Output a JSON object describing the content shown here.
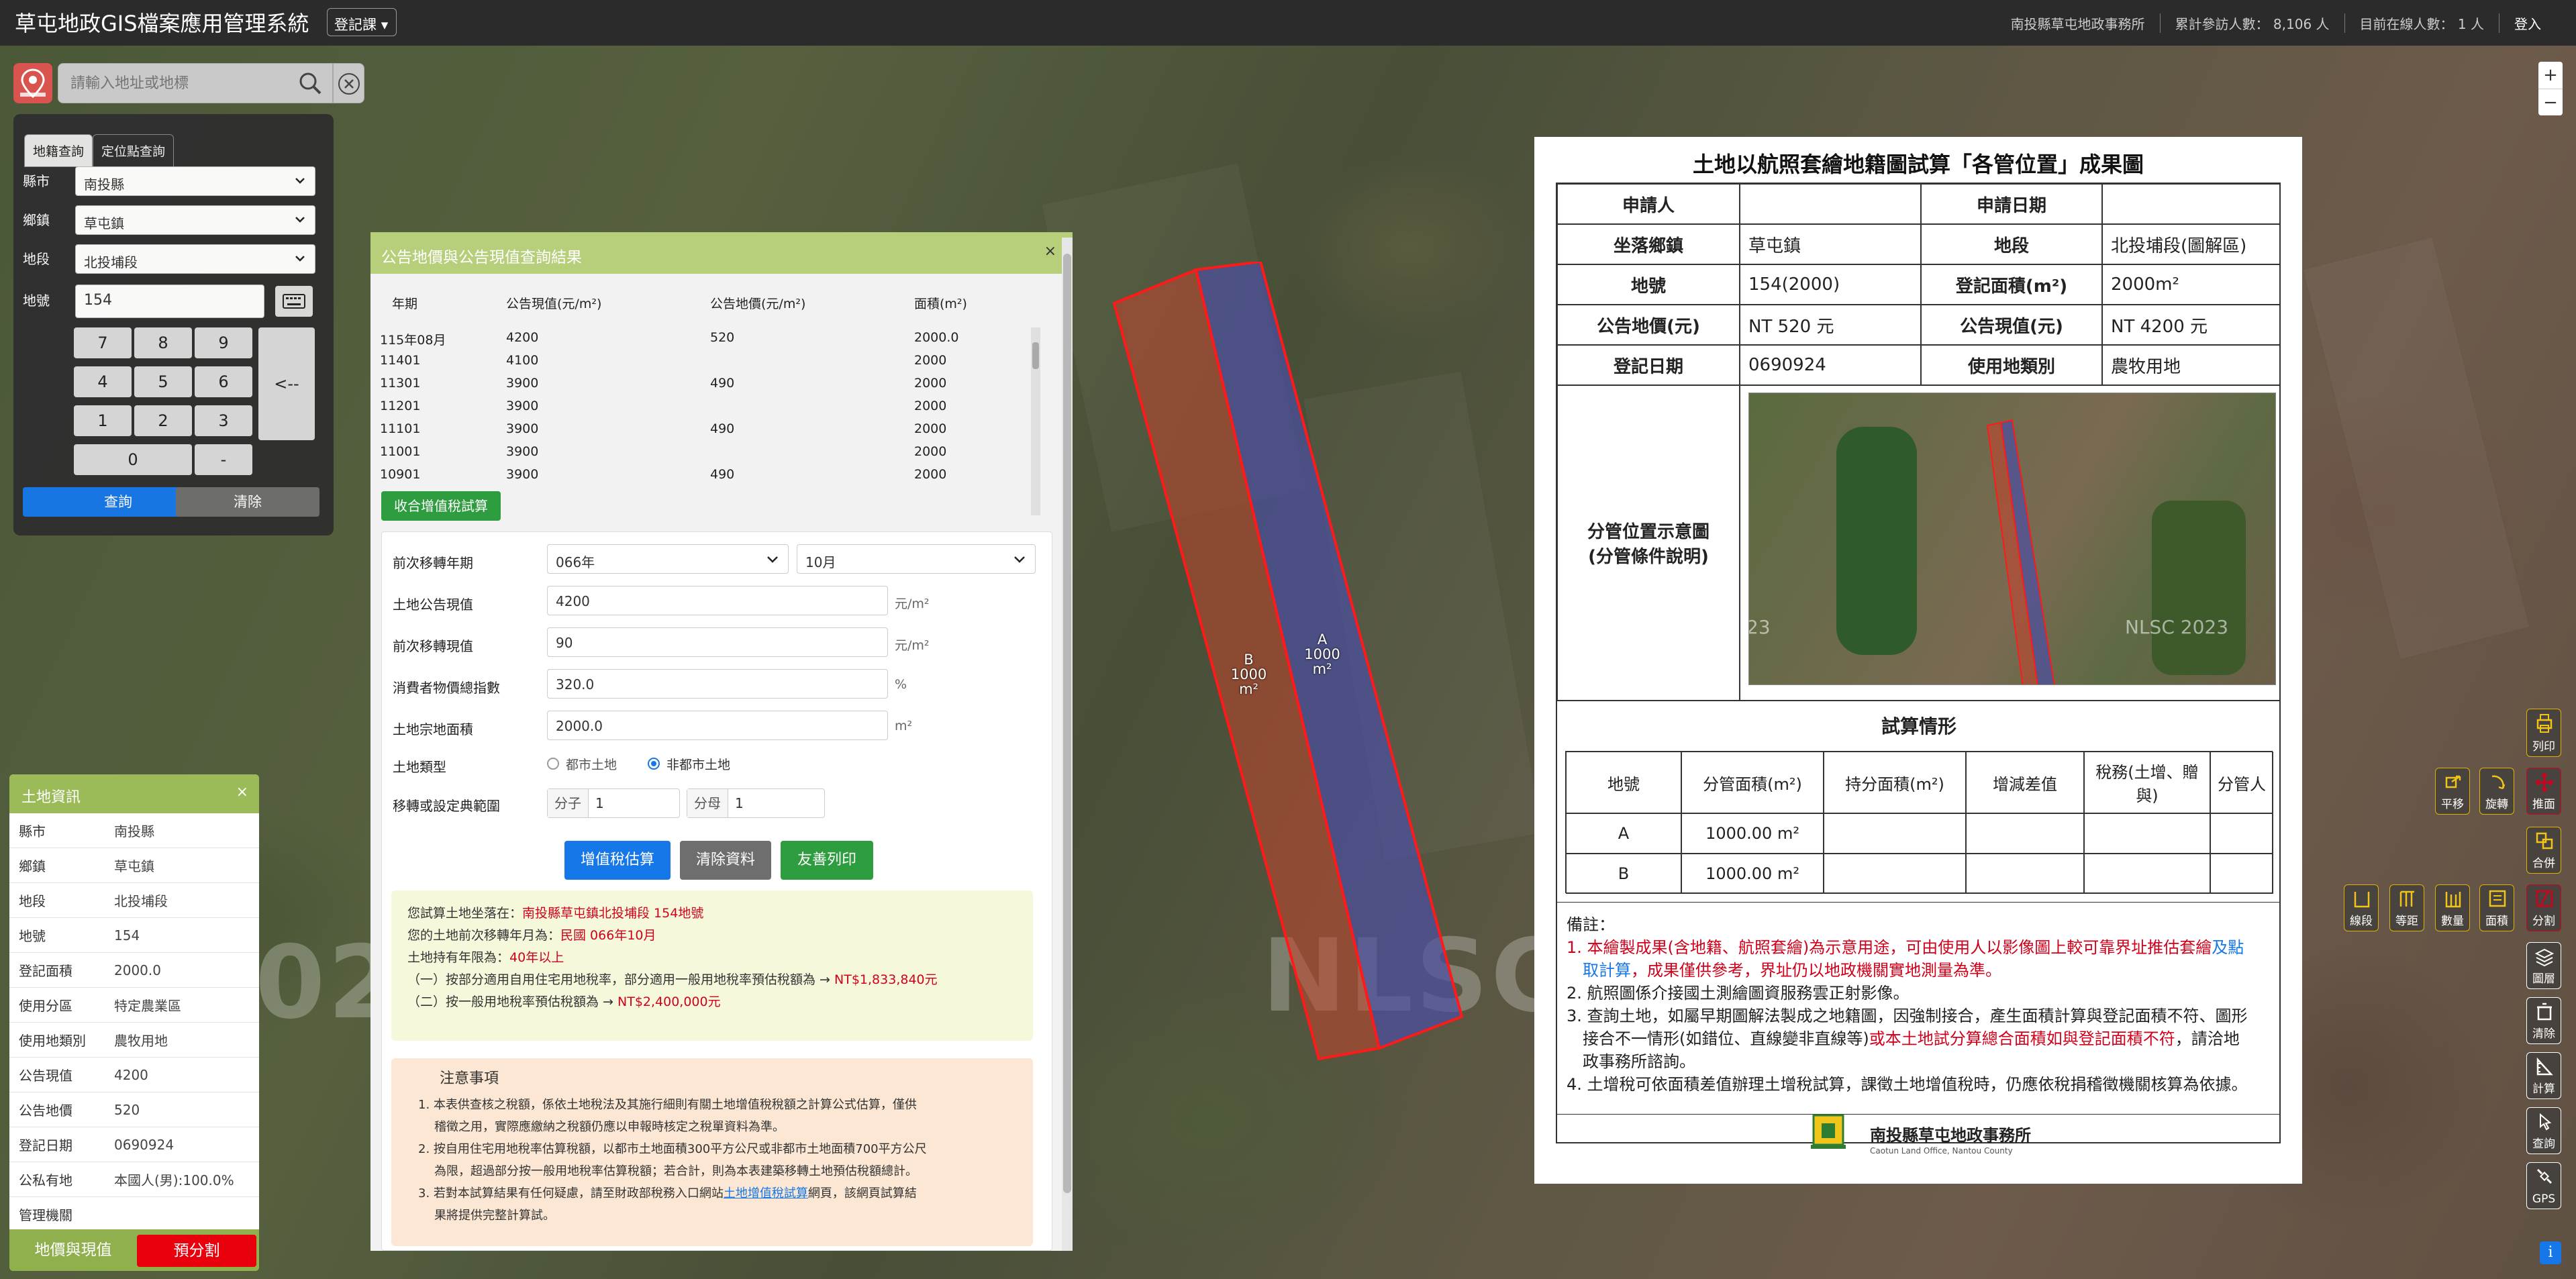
{
  "header": {
    "title": "草屯地政GIS檔案應用管理系統",
    "dropdown": "登記課",
    "office": "南投縣草屯地政事務所",
    "visits": "累計參訪人數： 8,106 人",
    "online": "目前在線人數： 1 人",
    "login": "登入"
  },
  "search": {
    "placeholder": "請輸入地址或地標"
  },
  "query": {
    "tab1": "地籍查詢",
    "tab2": "定位點查詢",
    "labels": {
      "county": "縣市",
      "town": "鄉鎮",
      "section": "地段",
      "lot": "地號"
    },
    "county": "南投縣",
    "town": "草屯鎮",
    "section": "北投埔段",
    "lot": "154",
    "keys": [
      "7",
      "8",
      "9",
      "4",
      "5",
      "6",
      "1",
      "2",
      "3",
      "0",
      "-"
    ],
    "backspace": "<--",
    "query_btn": "查詢",
    "clear_btn": "清除"
  },
  "landinfo": {
    "title": "土地資訊",
    "close": "×",
    "rows": [
      {
        "k": "縣市",
        "v": "南投縣"
      },
      {
        "k": "鄉鎮",
        "v": "草屯鎮"
      },
      {
        "k": "地段",
        "v": "北投埔段"
      },
      {
        "k": "地號",
        "v": "154"
      },
      {
        "k": "登記面積",
        "v": "2000.0"
      },
      {
        "k": "使用分區",
        "v": "特定農業區"
      },
      {
        "k": "使用地類別",
        "v": "農牧用地"
      },
      {
        "k": "公告現值",
        "v": "4200"
      },
      {
        "k": "公告地價",
        "v": "520"
      },
      {
        "k": "登記日期",
        "v": "0690924"
      },
      {
        "k": "公私有地",
        "v": "本國人(男):100.0%"
      },
      {
        "k": "管理機關",
        "v": ""
      }
    ],
    "btn_a": "地價與現值",
    "btn_b": "預分割"
  },
  "result": {
    "title": "公告地價與公告現值查詢結果",
    "close": "×",
    "headers": [
      "年期",
      "公告現值(元/m²)",
      "公告地價(元/m²)",
      "面積(m²)"
    ],
    "rows": [
      [
        "115年08月",
        "4200",
        "520",
        "2000.0"
      ],
      [
        "11401",
        "4100",
        "",
        "2000"
      ],
      [
        "11301",
        "3900",
        "490",
        "2000"
      ],
      [
        "11201",
        "3900",
        "",
        "2000"
      ],
      [
        "11101",
        "3900",
        "490",
        "2000"
      ],
      [
        "11001",
        "3900",
        "",
        "2000"
      ],
      [
        "10901",
        "3900",
        "490",
        "2000"
      ]
    ],
    "tax_btn": "收合增值稅試算",
    "form": {
      "prev_year_label": "前次移轉年期",
      "prev_year": "066年",
      "prev_month": "10月",
      "land_value_label": "土地公告現值",
      "land_value": "4200",
      "unit_m2": "元/m²",
      "prev_value_label": "前次移轉現值",
      "prev_value": "90",
      "cpi_label": "消費者物價總指數",
      "cpi": "320.0",
      "pct": "%",
      "area_label": "土地宗地面積",
      "area": "2000.0",
      "m2": "m²",
      "type_label": "土地類型",
      "type_urban": "都市土地",
      "type_non": "非都市土地",
      "range_label": "移轉或設定典範圍",
      "num_label": "分子",
      "num": "1",
      "den_label": "分母",
      "den": "1",
      "calc_btn": "增值稅估算",
      "clear_btn": "清除資料",
      "print_btn": "友善列印"
    },
    "info": {
      "l1a": "您試算土地坐落在：",
      "l1b": "南投縣草屯鎮北投埔段 154地號",
      "l2a": "您的土地前次移轉年月為：",
      "l2b": "民國 066年10月",
      "l3a": "土地持有年限為：",
      "l3b": "40年以上",
      "l4a": "（一）按部分適用自用住宅用地稅率，部分適用一般用地稅率預估稅額為 → ",
      "l4b": "NT$1,833,840元",
      "l5a": "（二）按一般用地稅率預估稅額為 → ",
      "l5b": "NT$2,400,000元"
    },
    "notes": {
      "title": "注意事項",
      "n1": "1. 本表供查核之稅額，係依土地稅法及其施行細則有關土地增值稅稅額之計算公式估算，僅供",
      "n1b": "稽徵之用，實際應繳納之稅額仍應以申報時核定之稅單資料為準。",
      "n2": "2. 按自用住宅用地稅率估算稅額，以都市土地面積300平方公尺或非都市土地面積700平方公尺",
      "n2b": "為限，超過部分按一般用地稅率估算稅額；若合計，則為本表建築移轉土地預估稅額總計。",
      "n3a": "3. 若對本試算結果有任何疑慮，請至財政部稅務入口網站",
      "n3link": "土地增值稅試算",
      "n3b": "網頁，該網頁試算結",
      "n3c": "果將提供完整計算試。"
    }
  },
  "map": {
    "parcelA": "A",
    "parcelAarea": "1000 m²",
    "parcelB": "B",
    "parcelBarea": "1000 m²",
    "watermark1": "NLSC 2",
    "watermark2": "023"
  },
  "report": {
    "title": "土地以航照套繪地籍圖試算「各管位置」成果圖",
    "applicant": "申請人",
    "apply_date": "申請日期",
    "town_label": "坐落鄉鎮",
    "town": "草屯鎮",
    "section_label": "地段",
    "section": "北投埔段(圖解區)",
    "lot_label": "地號",
    "lot": "154(2000)",
    "reg_area_label": "登記面積(m²)",
    "reg_area": "2000m²",
    "price_label": "公告地價(元)",
    "price": "NT 520 元",
    "value_label": "公告現值(元)",
    "value": "NT 4200 元",
    "reg_date_label": "登記日期",
    "reg_date": "0690924",
    "use_label": "使用地類別",
    "use": "農牧用地",
    "diagram_label1": "分管位置示意圖",
    "diagram_label2": "(分管條件說明)",
    "thumb_wm1": "NLSC 2023",
    "thumb_wm2": "23",
    "calc_title": "試算情形",
    "calc_headers": [
      "地號",
      "分管面積(m²)",
      "持分面積(m²)",
      "增減差值",
      "稅務(土增、贈與)",
      "分管人"
    ],
    "calc_rows": [
      [
        "A",
        "1000.00 m²"
      ],
      [
        "B",
        "1000.00 m²"
      ]
    ],
    "remarks_title": "備註：",
    "r1a": "1. 本繪製成果(含地籍、航照套繪)為示意用途，可由使用人以影像圖上較可靠界址推估套繪",
    "r1b": "及點",
    "r1c": "取計算",
    "r1d": "，成果僅供參考，界址仍以地政機關實地測量為準。",
    "r2": "2. 航照圖係介接國土測繪圖資服務雲正射影像。",
    "r3a": "3. 查詢土地，如屬早期圖解法製成之地籍圖，因強制接合，產生面積計算與登記面積不符、圖形",
    "r3b": "接合不一情形(如錯位、直線變非直線等)",
    "r3c": "或本土地試分算總合面積如與登記面積不符",
    "r3d": "，請洽地",
    "r3e": "政事務所諮詢。",
    "r4": "4. 土增稅可依面積差值辦理土增稅試算，課徵土地增值稅時，仍應依稅捐稽徵機關核算為依據。",
    "footer_name": "南投縣草屯地政事務所",
    "footer_en": "Caotun Land Office, Nantou County"
  },
  "tools": {
    "print": "列印",
    "pan": "平移",
    "rotate": "旋轉",
    "push": "推面",
    "merge": "合併",
    "split": "分割",
    "line": "線段",
    "equal": "等距",
    "count": "數量",
    "area": "面積",
    "layers": "圖層",
    "clear": "清除",
    "calc": "計算",
    "query": "查詢",
    "gps": "GPS",
    "zoom_in": "+",
    "zoom_out": "−"
  },
  "colors": {
    "accent_green": "#9bbb59",
    "red": "#d0021b",
    "blue": "#1677e8"
  }
}
